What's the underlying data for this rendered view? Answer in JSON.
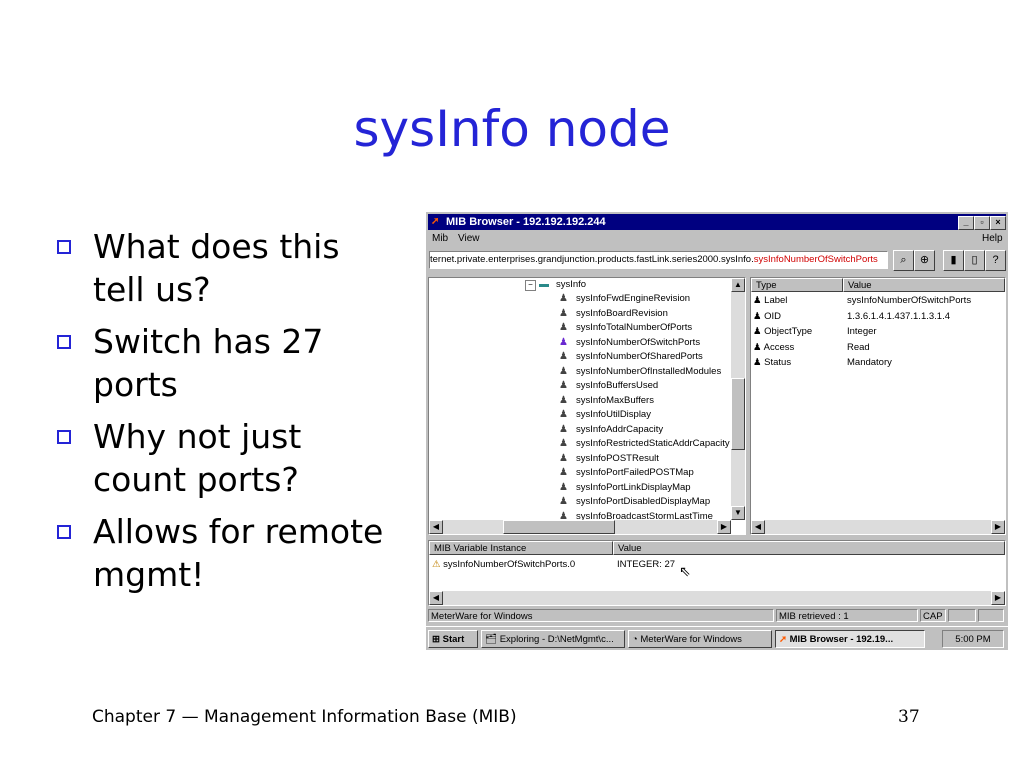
{
  "slide": {
    "title": "sysInfo node",
    "bullets": [
      "What does this tell us?",
      "Switch has 27 ports",
      "Why not just count ports?",
      "Allows for remote mgmt!"
    ],
    "footer": "Chapter 7 — Management Information Base (MIB)",
    "page_number": "37"
  },
  "window": {
    "title": "MIB Browser - 192.192.192.244",
    "menu": {
      "mib": "Mib",
      "view": "View",
      "help": "Help"
    },
    "address_prefix": "ternet.private.enterprises.grandjunction.products.fastLink.series2000.sysInfo.",
    "address_selected": "sysInfoNumberOfSwitchPorts",
    "tree_root": "sysInfo",
    "tree_items": [
      "sysInfoFwdEngineRevision",
      "sysInfoBoardRevision",
      "sysInfoTotalNumberOfPorts",
      "sysInfoNumberOfSwitchPorts",
      "sysInfoNumberOfSharedPorts",
      "sysInfoNumberOfInstalledModules",
      "sysInfoBuffersUsed",
      "sysInfoMaxBuffers",
      "sysInfoUtilDisplay",
      "sysInfoAddrCapacity",
      "sysInfoRestrictedStaticAddrCapacity",
      "sysInfoPOSTResult",
      "sysInfoPortFailedPOSTMap",
      "sysInfoPortLinkDisplayMap",
      "sysInfoPortDisabledDisplayMap",
      "sysInfoBroadcastStormLastTime"
    ],
    "props_headers": {
      "type": "Type",
      "value": "Value"
    },
    "props": [
      {
        "type": "Label",
        "value": "sysInfoNumberOfSwitchPorts"
      },
      {
        "type": "OID",
        "value": "1.3.6.1.4.1.437.1.1.3.1.4"
      },
      {
        "type": "ObjectType",
        "value": "Integer"
      },
      {
        "type": "Access",
        "value": "Read"
      },
      {
        "type": "Status",
        "value": "Mandatory"
      }
    ],
    "instance_headers": {
      "instance": "MIB Variable Instance",
      "value": "Value"
    },
    "instance": {
      "name": "sysInfoNumberOfSwitchPorts.0",
      "value": "INTEGER: 27"
    },
    "status": {
      "app": "MeterWare for Windows",
      "msg": "MIB retrieved : 1",
      "cap": "CAP"
    },
    "taskbar": {
      "start": "Start",
      "tasks": [
        "Exploring - D:\\NetMgmt\\c...",
        "MeterWare for Windows",
        "MIB Browser - 192.19..."
      ],
      "clock": "5:00 PM"
    }
  }
}
